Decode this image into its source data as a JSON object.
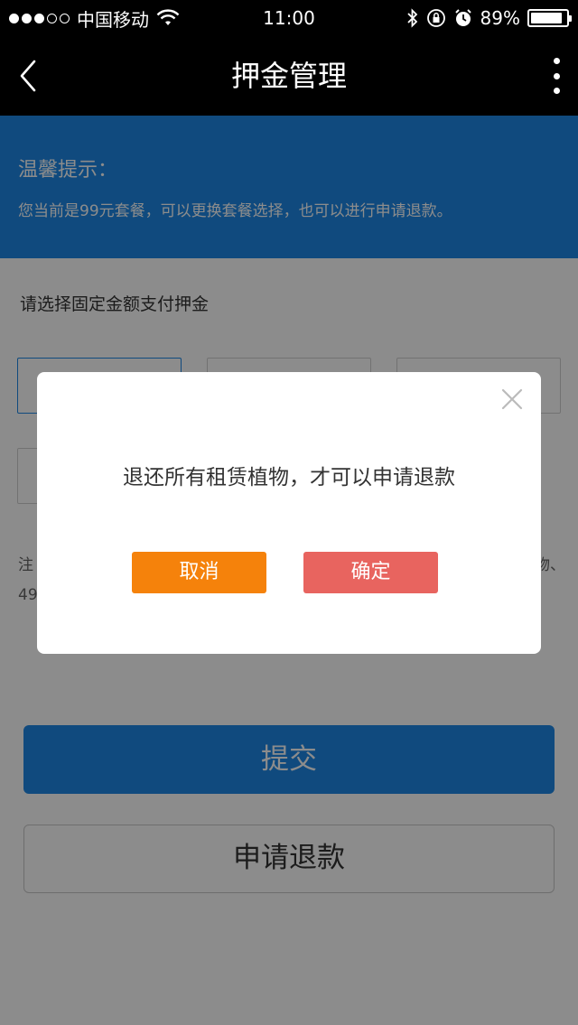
{
  "status_bar": {
    "carrier": "中国移动",
    "time": "11:00",
    "battery": "89%",
    "battery_level": 0.89,
    "icons": [
      "signal-icon",
      "wifi-icon",
      "bluetooth-icon",
      "rotation-lock-icon",
      "alarm-icon",
      "battery-icon"
    ]
  },
  "nav": {
    "title": "押金管理",
    "back_icon": "chevron-left-icon",
    "more_icon": "more-vertical-icon"
  },
  "tip": {
    "title": "温馨提示：",
    "text": "您当前是99元套餐，可以更换套餐选择，也可以进行申请退款。"
  },
  "main": {
    "section_label": "请选择固定金额支付押金",
    "note_left_top": "注",
    "note_left_bottom": "49",
    "note_right_top": "物、",
    "submit_label": "提交",
    "refund_label": "申请退款"
  },
  "dialog": {
    "message": "退还所有租赁植物，才可以申请退款",
    "cancel_label": "取消",
    "confirm_label": "确定",
    "close_icon": "close-icon"
  },
  "colors": {
    "primary_blue": "#1E88E5",
    "cancel_orange": "#F5820B",
    "confirm_red": "#E8645F"
  }
}
